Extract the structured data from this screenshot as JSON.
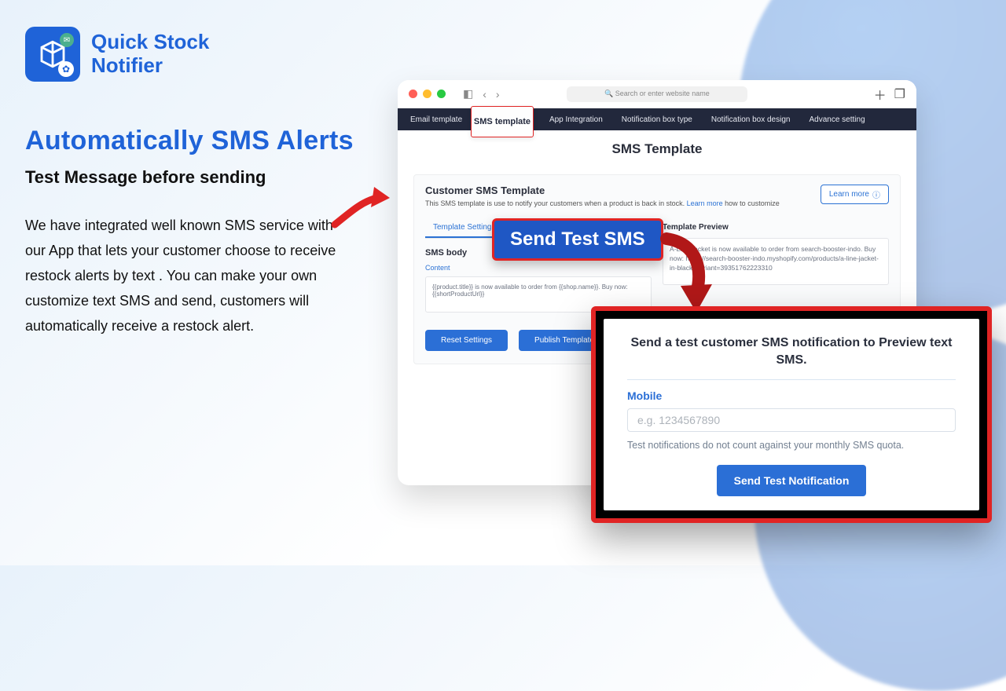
{
  "brand": {
    "line1": "Quick Stock",
    "line2": "Notifier"
  },
  "hero": {
    "title": "Automatically SMS Alerts",
    "subtitle": "Test Message before sending",
    "body": "We have integrated well known SMS service with our App that lets your customer choose to receive restock alerts by text . You can make your own customize text SMS and send, customers will automatically receive a restock alert."
  },
  "browser": {
    "search_placeholder": "🔍  Search or enter website name"
  },
  "tabs": {
    "email": "Email template",
    "sms": "SMS template",
    "integration": "App Integration",
    "box_type": "Notification box type",
    "box_design": "Notification box design",
    "advance": "Advance setting"
  },
  "panel": {
    "page_title": "SMS Template",
    "card_title": "Customer SMS Template",
    "card_desc_pre": "This SMS template is use to notify your customers when a product is back in stock. ",
    "learn_link": "Learn more",
    "card_desc_post": " how to customize",
    "learn_btn": "Learn more",
    "template_settings_tab": "Template Settings",
    "sms_body_label": "SMS body",
    "content_label": "Content",
    "sms_body_text": "{{product.title}} is now available to order from {{shop.name}}. Buy now: {{shortProductUrl}}",
    "preview_label": "Template Preview",
    "preview_text": "A-Line Jacket is now available to order from search-booster-indo. Buy now: https://search-booster-indo.myshopify.com/products/a-line-jacket-in-black?variant=39351762223310",
    "reset_btn": "Reset Settings",
    "publish_btn": "Publish Template"
  },
  "callouts": {
    "sms_tab": "SMS template",
    "send_test": "Send Test SMS"
  },
  "modal": {
    "title": "Send a test customer SMS notification to Preview text SMS.",
    "mobile_label": "Mobile",
    "mobile_placeholder": "e.g. 1234567890",
    "help": "Test notifications do not count against your monthly SMS quota.",
    "button": "Send Test Notification"
  }
}
